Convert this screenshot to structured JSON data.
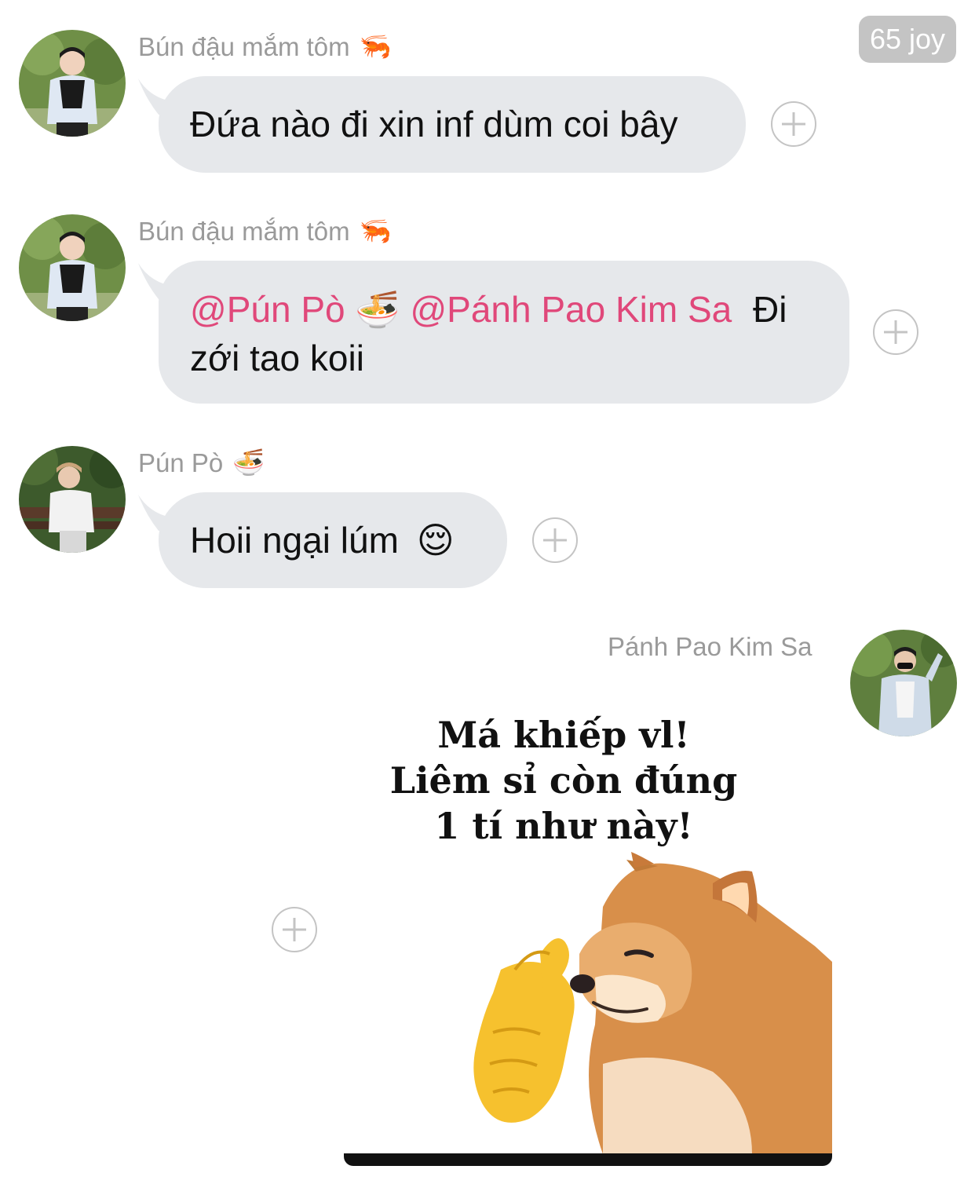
{
  "header": {
    "badge_label": "65 joy"
  },
  "messages": [
    {
      "sender": "Bún đậu mắm tôm",
      "sender_emoji": "🦐",
      "text": "Đứa nào đi xin inf dùm coi bây"
    },
    {
      "sender": "Bún đậu mắm tôm",
      "sender_emoji": "🦐",
      "mention_1": "@Pún Pò",
      "mention_1_emoji": "🍜",
      "mention_2": "@Pánh Pao Kim Sa",
      "text_line1": "Đi",
      "text_line2": "zới tao koii"
    },
    {
      "sender": "Pún Pò",
      "sender_emoji": "🍜",
      "text": "Hoii ngại lúm",
      "text_emoji": "😌"
    },
    {
      "sender": "Pánh Pao Kim Sa",
      "sticker": {
        "caption_line1": "Má khiếp vl!",
        "caption_line2": "Liêm sỉ còn đúng",
        "caption_line3": "1 tí như này!",
        "icon": "cheems-shiba-pinch-sticker"
      }
    }
  ],
  "colors": {
    "bubble": "#e6e8eb",
    "mention": "#e0487a",
    "sender_name": "#9a9a9a",
    "badge_bg": "#c4c4c4"
  }
}
